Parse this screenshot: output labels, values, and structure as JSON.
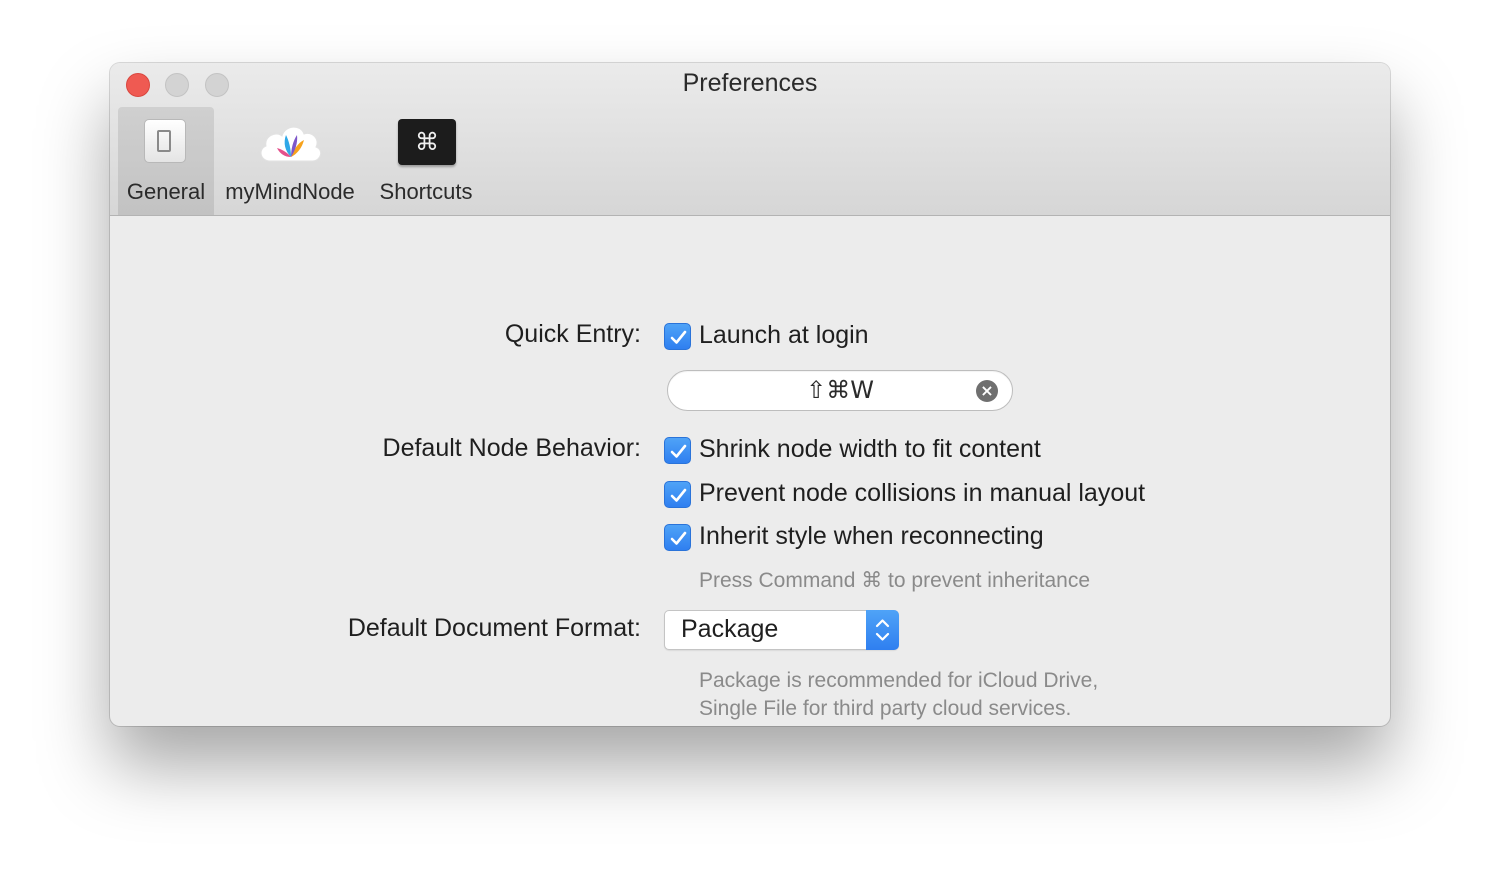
{
  "window": {
    "title": "Preferences",
    "traffic_lights": [
      "close",
      "minimize",
      "zoom"
    ]
  },
  "toolbar": {
    "tabs": [
      {
        "label": "General",
        "icon": "switch-icon",
        "selected": true
      },
      {
        "label": "myMindNode",
        "icon": "mymindnode-cloud-icon",
        "selected": false
      },
      {
        "label": "Shortcuts",
        "icon": "command-key-icon",
        "selected": false
      }
    ],
    "shortcuts_icon_glyph": "⌘"
  },
  "general": {
    "quick_entry": {
      "label": "Quick Entry:",
      "launch_at_login": {
        "label": "Launch at login",
        "checked": true
      },
      "shortcut": "⇧⌘W",
      "clear_glyph": "×"
    },
    "node_behavior": {
      "label": "Default Node Behavior:",
      "options": [
        {
          "label": "Shrink node width to fit content",
          "checked": true
        },
        {
          "label": "Prevent node collisions in manual layout",
          "checked": true
        },
        {
          "label": "Inherit style when reconnecting",
          "checked": true
        }
      ],
      "hint": "Press Command ⌘ to prevent inheritance"
    },
    "document_format": {
      "label": "Default Document Format:",
      "selected": "Package",
      "hint_line1": "Package is recommended for iCloud Drive,",
      "hint_line2": "Single File for third party cloud services."
    }
  },
  "colors": {
    "accent": "#3b8ff5",
    "close_light": "#ef5a52",
    "window_bg": "#ececec"
  }
}
